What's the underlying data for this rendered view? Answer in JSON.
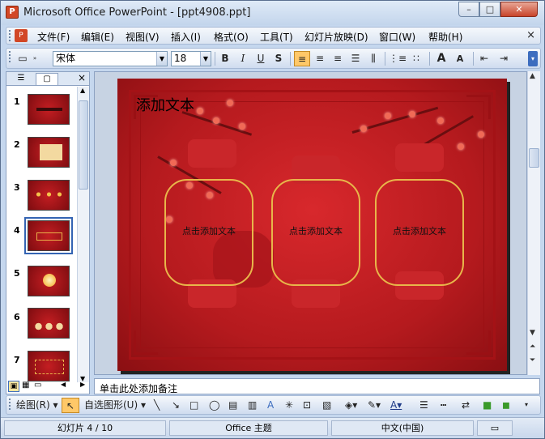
{
  "window": {
    "title": "Microsoft Office PowerPoint - [ppt4908.ppt]",
    "controls": {
      "minimize": "–",
      "maximize": "□",
      "close": "✕"
    }
  },
  "menubar": {
    "items": [
      {
        "label": "文件(F)"
      },
      {
        "label": "编辑(E)"
      },
      {
        "label": "视图(V)"
      },
      {
        "label": "插入(I)"
      },
      {
        "label": "格式(O)"
      },
      {
        "label": "工具(T)"
      },
      {
        "label": "幻灯片放映(D)"
      },
      {
        "label": "窗口(W)"
      },
      {
        "label": "帮助(H)"
      }
    ],
    "close": "×"
  },
  "toolbar": {
    "font_name": "宋体",
    "font_size": "18",
    "bold": "B",
    "italic": "I",
    "underline": "U",
    "shadow": "S",
    "font_grow": "A",
    "font_shrink": "A"
  },
  "left_panel": {
    "close": "×",
    "slides": [
      {
        "num": "1"
      },
      {
        "num": "2"
      },
      {
        "num": "3"
      },
      {
        "num": "4"
      },
      {
        "num": "5"
      },
      {
        "num": "6"
      },
      {
        "num": "7"
      }
    ],
    "selected_index": 4
  },
  "slide": {
    "title": "添加文本",
    "placeholders": [
      "点击添加文本",
      "点击添加文本",
      "点击添加文本"
    ]
  },
  "notes": {
    "placeholder": "单击此处添加备注"
  },
  "drawbar": {
    "draw": "绘图(R)",
    "autoshapes": "自选图形(U)"
  },
  "statusbar": {
    "slide_info": "幻灯片 4 / 10",
    "theme": "Office 主题",
    "language": "中文(中国)"
  },
  "colors": {
    "slide_red": "#c41e22",
    "frame_gold": "#e8b64a",
    "selection_blue": "#3464b3",
    "active_button": "#ffc868"
  }
}
